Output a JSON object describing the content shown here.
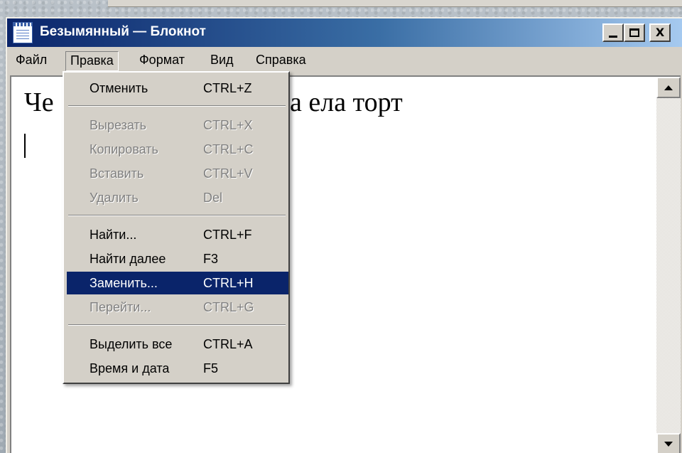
{
  "window": {
    "title": "Безымянный — Блокнот",
    "icon": "notepad-icon"
  },
  "controls": {
    "minimize_icon": "minimize-icon",
    "maximize_icon": "maximize-icon",
    "close_glyph": "X"
  },
  "menubar": {
    "items": [
      {
        "label": "Файл"
      },
      {
        "label": "Правка"
      },
      {
        "label": "Формат"
      },
      {
        "label": "Вид"
      },
      {
        "label": "Справка"
      }
    ],
    "open_menu": "Правка"
  },
  "editor": {
    "visible_text_left": "Че",
    "visible_text_right": "а ела торт"
  },
  "edit_menu": {
    "items": [
      {
        "label": "Отменить",
        "shortcut": "CTRL+Z",
        "enabled": true
      },
      {
        "label": "Вырезать",
        "shortcut": "CTRL+X",
        "enabled": false
      },
      {
        "label": "Копировать",
        "shortcut": "CTRL+C",
        "enabled": false
      },
      {
        "label": "Вставить",
        "shortcut": "CTRL+V",
        "enabled": false
      },
      {
        "label": "Удалить",
        "shortcut": "Del",
        "enabled": false
      },
      {
        "label": "Найти...",
        "shortcut": "CTRL+F",
        "enabled": true
      },
      {
        "label": "Найти далее",
        "shortcut": "F3",
        "enabled": true
      },
      {
        "label": "Заменить...",
        "shortcut": "CTRL+H",
        "enabled": true,
        "highlighted": true
      },
      {
        "label": "Перейти...",
        "shortcut": "CTRL+G",
        "enabled": false
      },
      {
        "label": "Выделить все",
        "shortcut": "CTRL+A",
        "enabled": true
      },
      {
        "label": "Время и дата",
        "shortcut": "F5",
        "enabled": true
      }
    ]
  },
  "colors": {
    "title_gradient_start": "#0a246a",
    "title_gradient_end": "#a6caf0",
    "highlight": "#0a246a",
    "face": "#d4d0c8"
  }
}
